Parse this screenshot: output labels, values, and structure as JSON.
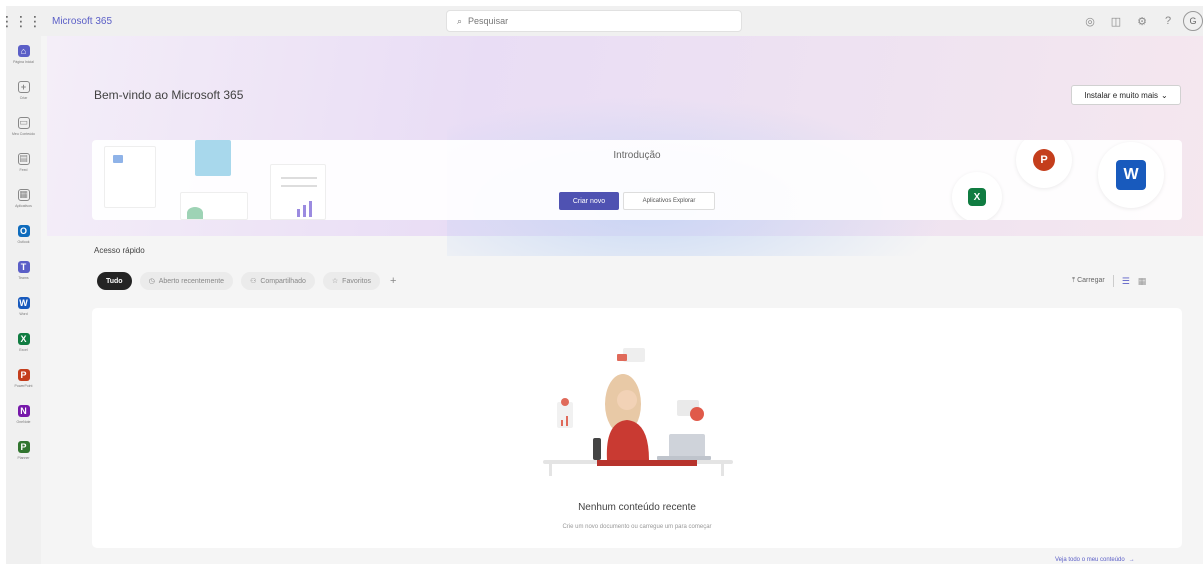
{
  "topbar": {
    "app_name": "Microsoft 365",
    "search_placeholder": "Pesquisar",
    "avatar_initial": "G"
  },
  "rail": {
    "items": [
      {
        "label": "Página Inicial",
        "icon": "home-icon",
        "color": "#5b5fc7"
      },
      {
        "label": "Criar",
        "icon": "create-icon",
        "color": "#888888"
      },
      {
        "label": "Meu Conteúdo",
        "icon": "folder-icon",
        "color": "#888888"
      },
      {
        "label": "Feed",
        "icon": "feed-icon",
        "color": "#888888"
      },
      {
        "label": "Aplicativos",
        "icon": "apps-icon",
        "color": "#888888"
      },
      {
        "label": "Outlook",
        "icon": "outlook-icon",
        "color": "#0f6cbd"
      },
      {
        "label": "Teams",
        "icon": "teams-icon",
        "color": "#5b5fc7"
      },
      {
        "label": "Word",
        "icon": "word-icon",
        "color": "#185abd"
      },
      {
        "label": "Excel",
        "icon": "excel-icon",
        "color": "#107c41"
      },
      {
        "label": "PowerPoint",
        "icon": "powerpoint-icon",
        "color": "#c43e1c"
      },
      {
        "label": "OneNote",
        "icon": "onenote-icon",
        "color": "#7719aa"
      },
      {
        "label": "Planner",
        "icon": "planner-icon",
        "color": "#31752f"
      }
    ]
  },
  "hero": {
    "welcome": "Bem-vindo ao Microsoft 365",
    "install_label": "Instalar e muito mais",
    "intro_title": "Introdução",
    "create_new": "Criar novo",
    "explore_apps": "Aplicativos Explorar"
  },
  "quick_access": {
    "title": "Acesso rápido",
    "filters": [
      {
        "label": "Tudo",
        "active": true
      },
      {
        "label": "Aberto recentemente",
        "active": false
      },
      {
        "label": "Compartilhado",
        "active": false
      },
      {
        "label": "Favoritos",
        "active": false
      }
    ],
    "add_label": "+",
    "upload_label": "Carregar"
  },
  "empty_state": {
    "title": "Nenhum conteúdo recente",
    "subtitle": "Crie um novo documento ou carregue um para começar"
  },
  "footer": {
    "see_all": "Veja todo o meu conteúdo"
  },
  "colors": {
    "brand": "#5b5fc7",
    "primary_button": "#4f52b2",
    "word": "#185abd",
    "excel": "#107c41",
    "powerpoint": "#c43e1c"
  }
}
